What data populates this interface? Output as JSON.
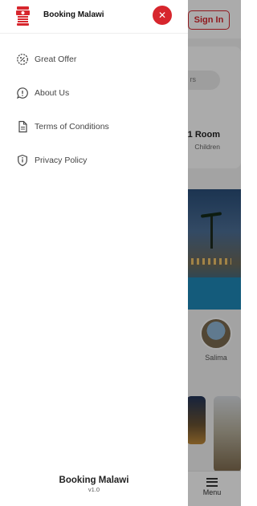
{
  "app": {
    "name": "Booking Malawi",
    "version": "v1.0"
  },
  "drawer": {
    "title": "Booking Malawi",
    "items": [
      {
        "label": "Great Offer",
        "icon": "offer-icon"
      },
      {
        "label": "About Us",
        "icon": "info-bubble-icon"
      },
      {
        "label": "Terms of Conditions",
        "icon": "document-icon"
      },
      {
        "label": "Privacy Policy",
        "icon": "shield-icon"
      }
    ],
    "close_icon": "close-icon"
  },
  "background": {
    "sign_in_label": "Sign In",
    "search_pill_text": "rs",
    "room_summary": "1 Room",
    "room_sub": "Children",
    "destination_label": "Salima",
    "bottom_menu_label": "Menu"
  },
  "colors": {
    "accent": "#d7262d",
    "scrim": "rgba(0,0,0,0.33)"
  }
}
